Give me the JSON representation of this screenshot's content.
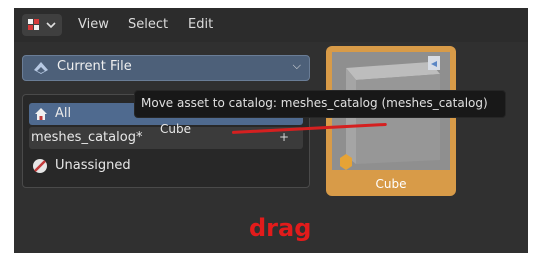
{
  "header": {
    "menus": [
      "View",
      "Select",
      "Edit"
    ]
  },
  "library": {
    "selected": "Current File"
  },
  "catalog_tree": {
    "items": [
      {
        "label": "All"
      },
      {
        "label": "meshes_catalog*"
      },
      {
        "label": "Unassigned"
      }
    ]
  },
  "drag_preview": {
    "label": "Cube"
  },
  "tooltip": {
    "text": "Move asset to catalog: meshes_catalog (meshes_catalog)"
  },
  "asset": {
    "name": "Cube"
  },
  "annotation": {
    "text": "drag",
    "color": "#e21b1b"
  },
  "colors": {
    "accent": "#4f6a8f",
    "asset_selected": "#d89b48"
  }
}
